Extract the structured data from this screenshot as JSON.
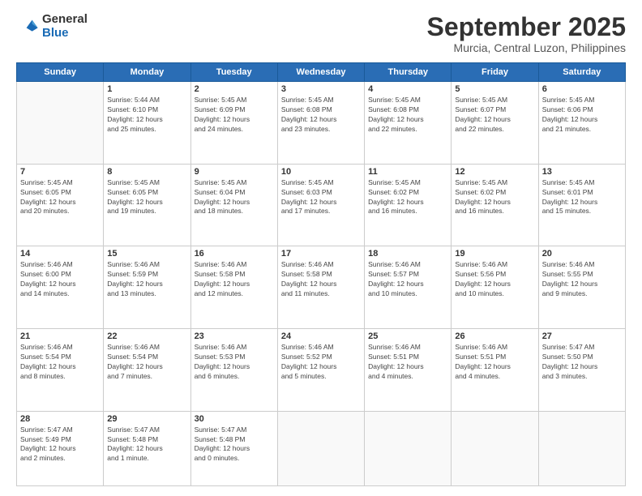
{
  "logo": {
    "line1": "General",
    "line2": "Blue"
  },
  "title": "September 2025",
  "subtitle": "Murcia, Central Luzon, Philippines",
  "days_of_week": [
    "Sunday",
    "Monday",
    "Tuesday",
    "Wednesday",
    "Thursday",
    "Friday",
    "Saturday"
  ],
  "weeks": [
    [
      {
        "day": "",
        "info": ""
      },
      {
        "day": "1",
        "info": "Sunrise: 5:44 AM\nSunset: 6:10 PM\nDaylight: 12 hours\nand 25 minutes."
      },
      {
        "day": "2",
        "info": "Sunrise: 5:45 AM\nSunset: 6:09 PM\nDaylight: 12 hours\nand 24 minutes."
      },
      {
        "day": "3",
        "info": "Sunrise: 5:45 AM\nSunset: 6:08 PM\nDaylight: 12 hours\nand 23 minutes."
      },
      {
        "day": "4",
        "info": "Sunrise: 5:45 AM\nSunset: 6:08 PM\nDaylight: 12 hours\nand 22 minutes."
      },
      {
        "day": "5",
        "info": "Sunrise: 5:45 AM\nSunset: 6:07 PM\nDaylight: 12 hours\nand 22 minutes."
      },
      {
        "day": "6",
        "info": "Sunrise: 5:45 AM\nSunset: 6:06 PM\nDaylight: 12 hours\nand 21 minutes."
      }
    ],
    [
      {
        "day": "7",
        "info": "Sunrise: 5:45 AM\nSunset: 6:05 PM\nDaylight: 12 hours\nand 20 minutes."
      },
      {
        "day": "8",
        "info": "Sunrise: 5:45 AM\nSunset: 6:05 PM\nDaylight: 12 hours\nand 19 minutes."
      },
      {
        "day": "9",
        "info": "Sunrise: 5:45 AM\nSunset: 6:04 PM\nDaylight: 12 hours\nand 18 minutes."
      },
      {
        "day": "10",
        "info": "Sunrise: 5:45 AM\nSunset: 6:03 PM\nDaylight: 12 hours\nand 17 minutes."
      },
      {
        "day": "11",
        "info": "Sunrise: 5:45 AM\nSunset: 6:02 PM\nDaylight: 12 hours\nand 16 minutes."
      },
      {
        "day": "12",
        "info": "Sunrise: 5:45 AM\nSunset: 6:02 PM\nDaylight: 12 hours\nand 16 minutes."
      },
      {
        "day": "13",
        "info": "Sunrise: 5:45 AM\nSunset: 6:01 PM\nDaylight: 12 hours\nand 15 minutes."
      }
    ],
    [
      {
        "day": "14",
        "info": "Sunrise: 5:46 AM\nSunset: 6:00 PM\nDaylight: 12 hours\nand 14 minutes."
      },
      {
        "day": "15",
        "info": "Sunrise: 5:46 AM\nSunset: 5:59 PM\nDaylight: 12 hours\nand 13 minutes."
      },
      {
        "day": "16",
        "info": "Sunrise: 5:46 AM\nSunset: 5:58 PM\nDaylight: 12 hours\nand 12 minutes."
      },
      {
        "day": "17",
        "info": "Sunrise: 5:46 AM\nSunset: 5:58 PM\nDaylight: 12 hours\nand 11 minutes."
      },
      {
        "day": "18",
        "info": "Sunrise: 5:46 AM\nSunset: 5:57 PM\nDaylight: 12 hours\nand 10 minutes."
      },
      {
        "day": "19",
        "info": "Sunrise: 5:46 AM\nSunset: 5:56 PM\nDaylight: 12 hours\nand 10 minutes."
      },
      {
        "day": "20",
        "info": "Sunrise: 5:46 AM\nSunset: 5:55 PM\nDaylight: 12 hours\nand 9 minutes."
      }
    ],
    [
      {
        "day": "21",
        "info": "Sunrise: 5:46 AM\nSunset: 5:54 PM\nDaylight: 12 hours\nand 8 minutes."
      },
      {
        "day": "22",
        "info": "Sunrise: 5:46 AM\nSunset: 5:54 PM\nDaylight: 12 hours\nand 7 minutes."
      },
      {
        "day": "23",
        "info": "Sunrise: 5:46 AM\nSunset: 5:53 PM\nDaylight: 12 hours\nand 6 minutes."
      },
      {
        "day": "24",
        "info": "Sunrise: 5:46 AM\nSunset: 5:52 PM\nDaylight: 12 hours\nand 5 minutes."
      },
      {
        "day": "25",
        "info": "Sunrise: 5:46 AM\nSunset: 5:51 PM\nDaylight: 12 hours\nand 4 minutes."
      },
      {
        "day": "26",
        "info": "Sunrise: 5:46 AM\nSunset: 5:51 PM\nDaylight: 12 hours\nand 4 minutes."
      },
      {
        "day": "27",
        "info": "Sunrise: 5:47 AM\nSunset: 5:50 PM\nDaylight: 12 hours\nand 3 minutes."
      }
    ],
    [
      {
        "day": "28",
        "info": "Sunrise: 5:47 AM\nSunset: 5:49 PM\nDaylight: 12 hours\nand 2 minutes."
      },
      {
        "day": "29",
        "info": "Sunrise: 5:47 AM\nSunset: 5:48 PM\nDaylight: 12 hours\nand 1 minute."
      },
      {
        "day": "30",
        "info": "Sunrise: 5:47 AM\nSunset: 5:48 PM\nDaylight: 12 hours\nand 0 minutes."
      },
      {
        "day": "",
        "info": ""
      },
      {
        "day": "",
        "info": ""
      },
      {
        "day": "",
        "info": ""
      },
      {
        "day": "",
        "info": ""
      }
    ]
  ]
}
